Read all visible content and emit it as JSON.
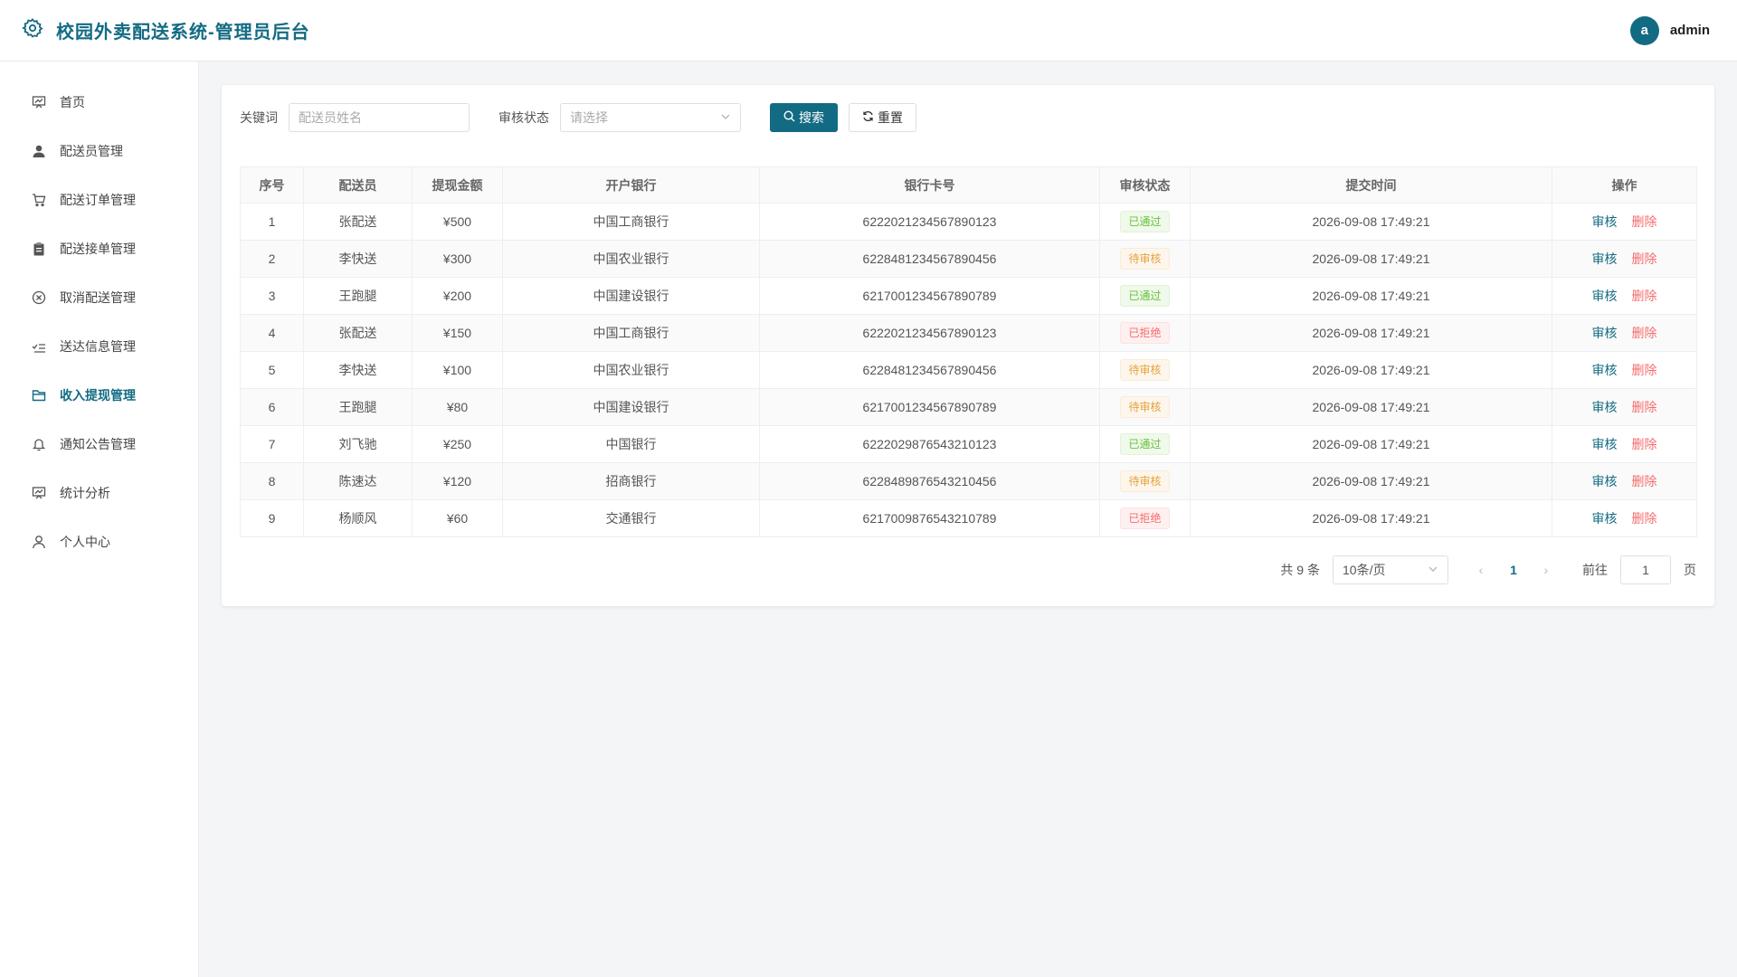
{
  "header": {
    "title": "校园外卖配送系统-管理员后台",
    "avatar_letter": "a",
    "username": "admin"
  },
  "sidebar": {
    "items": [
      {
        "label": "首页",
        "icon": "chart-board-icon"
      },
      {
        "label": "配送员管理",
        "icon": "user-icon"
      },
      {
        "label": "配送订单管理",
        "icon": "cart-icon"
      },
      {
        "label": "配送接单管理",
        "icon": "clipboard-icon"
      },
      {
        "label": "取消配送管理",
        "icon": "circle-x-icon"
      },
      {
        "label": "送达信息管理",
        "icon": "check-list-icon"
      },
      {
        "label": "收入提现管理",
        "icon": "folder-icon",
        "active": true
      },
      {
        "label": "通知公告管理",
        "icon": "bell-icon"
      },
      {
        "label": "统计分析",
        "icon": "chart-board-icon"
      },
      {
        "label": "个人中心",
        "icon": "user-outline-icon"
      }
    ]
  },
  "filter": {
    "keyword_label": "关键词",
    "keyword_placeholder": "配送员姓名",
    "status_label": "审核状态",
    "status_placeholder": "请选择",
    "search_label": "搜索",
    "reset_label": "重置"
  },
  "table": {
    "headers": [
      "序号",
      "配送员",
      "提现金额",
      "开户银行",
      "银行卡号",
      "审核状态",
      "提交时间",
      "操作"
    ],
    "audit_label": "审核",
    "delete_label": "删除",
    "rows": [
      {
        "no": "1",
        "name": "张配送",
        "amount": "¥500",
        "bank": "中国工商银行",
        "card": "6222021234567890123",
        "status": "已通过",
        "status_type": "ok",
        "time": "2026-09-08 17:49:21"
      },
      {
        "no": "2",
        "name": "李快送",
        "amount": "¥300",
        "bank": "中国农业银行",
        "card": "6228481234567890456",
        "status": "待审核",
        "status_type": "wait",
        "time": "2026-09-08 17:49:21"
      },
      {
        "no": "3",
        "name": "王跑腿",
        "amount": "¥200",
        "bank": "中国建设银行",
        "card": "6217001234567890789",
        "status": "已通过",
        "status_type": "ok",
        "time": "2026-09-08 17:49:21"
      },
      {
        "no": "4",
        "name": "张配送",
        "amount": "¥150",
        "bank": "中国工商银行",
        "card": "6222021234567890123",
        "status": "已拒绝",
        "status_type": "rej",
        "time": "2026-09-08 17:49:21"
      },
      {
        "no": "5",
        "name": "李快送",
        "amount": "¥100",
        "bank": "中国农业银行",
        "card": "6228481234567890456",
        "status": "待审核",
        "status_type": "wait",
        "time": "2026-09-08 17:49:21"
      },
      {
        "no": "6",
        "name": "王跑腿",
        "amount": "¥80",
        "bank": "中国建设银行",
        "card": "6217001234567890789",
        "status": "待审核",
        "status_type": "wait",
        "time": "2026-09-08 17:49:21"
      },
      {
        "no": "7",
        "name": "刘飞驰",
        "amount": "¥250",
        "bank": "中国银行",
        "card": "6222029876543210123",
        "status": "已通过",
        "status_type": "ok",
        "time": "2026-09-08 17:49:21"
      },
      {
        "no": "8",
        "name": "陈速达",
        "amount": "¥120",
        "bank": "招商银行",
        "card": "6228489876543210456",
        "status": "待审核",
        "status_type": "wait",
        "time": "2026-09-08 17:49:21"
      },
      {
        "no": "9",
        "name": "杨顺风",
        "amount": "¥60",
        "bank": "交通银行",
        "card": "6217009876543210789",
        "status": "已拒绝",
        "status_type": "rej",
        "time": "2026-09-08 17:49:21"
      }
    ]
  },
  "pager": {
    "total": "共 9 条",
    "page_size": "10条/页",
    "current": "1",
    "goto_label": "前往",
    "goto_value": "1",
    "page_suffix": "页"
  },
  "colors": {
    "accent": "#136b83",
    "ok": "#67c23a",
    "wait": "#e6a23c",
    "reject": "#f56c6c"
  }
}
